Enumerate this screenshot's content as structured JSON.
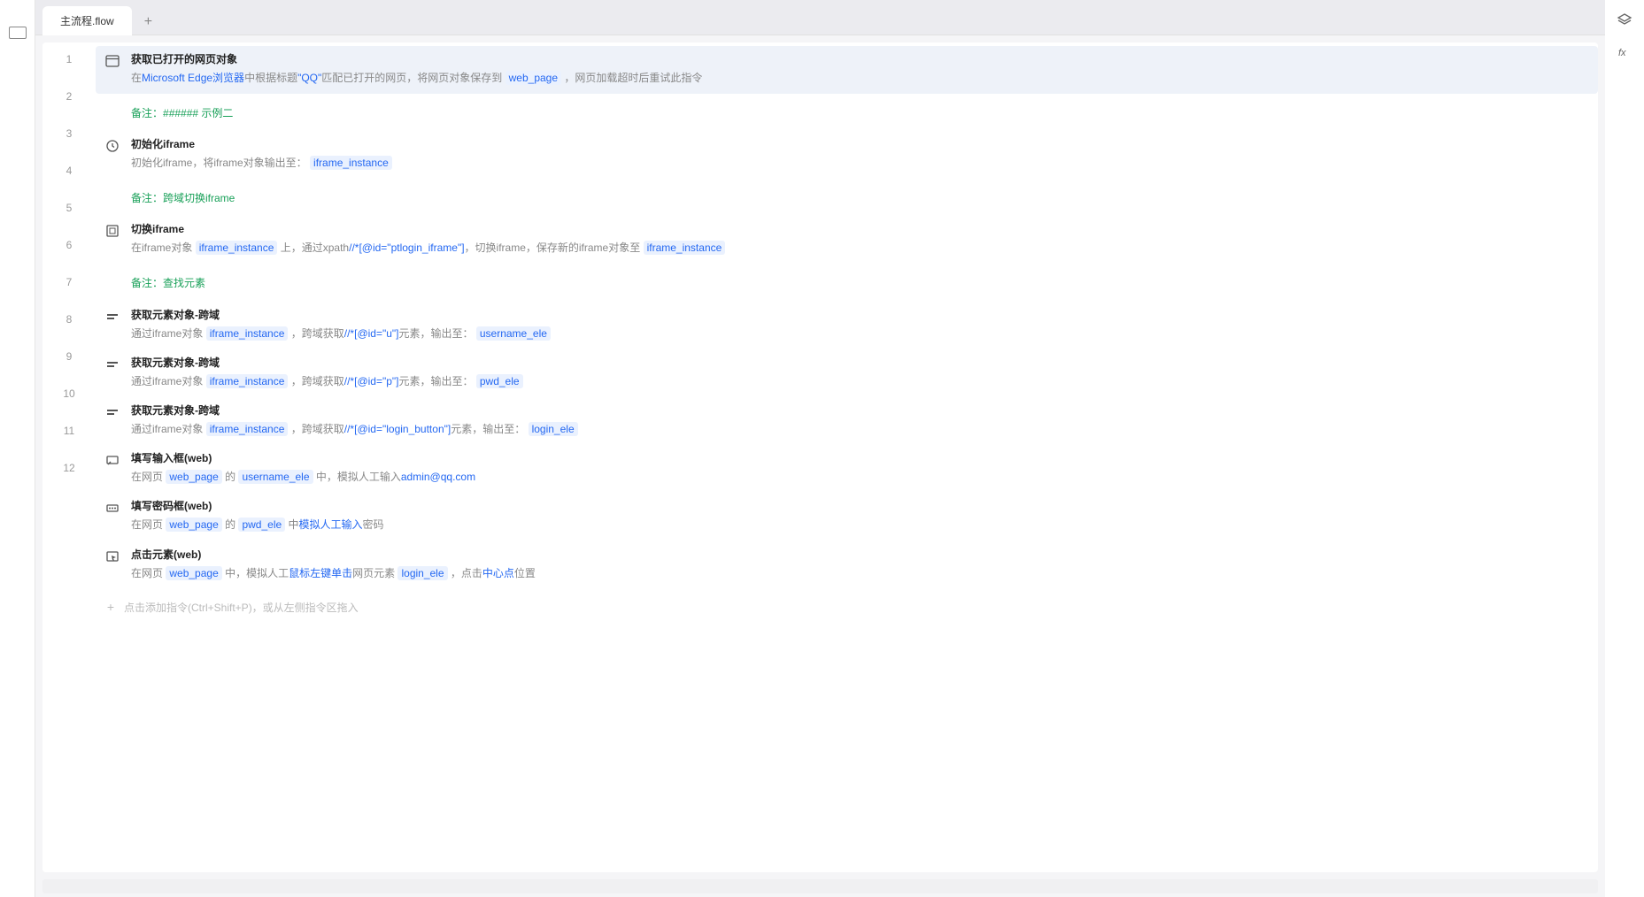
{
  "tabs": {
    "active": "主流程.flow"
  },
  "lines": [
    "1",
    "2",
    "3",
    "4",
    "5",
    "6",
    "7",
    "8",
    "9",
    "10",
    "11",
    "12"
  ],
  "steps": {
    "s1": {
      "title": "获取已打开的网页对象",
      "d1": "在",
      "d2": "Microsoft Edge浏览器",
      "d3": "中根据标题",
      "d4": "\"QQ\"",
      "d5": "匹配已打开的网页，将网页对象保存到",
      "d6": "web_page",
      "d7": "，网页加载超时后重试此指令"
    },
    "n1": {
      "label": "备注：",
      "text": "###### 示例二"
    },
    "s2": {
      "title": "初始化iframe",
      "d1": "初始化iframe，将iframe对象输出至：",
      "d2": "iframe_instance"
    },
    "n2": {
      "label": "备注：",
      "text": "跨域切换iframe"
    },
    "s3": {
      "title": "切换iframe",
      "d1": "在iframe对象",
      "d2": "iframe_instance",
      "d3": "上，通过xpath",
      "d4": "//*[@id=\"ptlogin_iframe\"]",
      "d5": "，切换iframe，保存新的iframe对象至",
      "d6": "iframe_instance"
    },
    "n3": {
      "label": "备注：",
      "text": "查找元素"
    },
    "s4": {
      "title": "获取元素对象-跨域",
      "d1": "通过iframe对象",
      "d2": "iframe_instance",
      "d3": "，跨域获取",
      "d4": "//*[@id=\"u\"]",
      "d5": "元素，输出至：",
      "d6": "username_ele"
    },
    "s5": {
      "title": "获取元素对象-跨域",
      "d1": "通过iframe对象",
      "d2": "iframe_instance",
      "d3": "，跨域获取",
      "d4": "//*[@id=\"p\"]",
      "d5": "元素，输出至：",
      "d6": "pwd_ele"
    },
    "s6": {
      "title": "获取元素对象-跨域",
      "d1": "通过iframe对象",
      "d2": "iframe_instance",
      "d3": "，跨域获取",
      "d4": "//*[@id=\"login_button\"]",
      "d5": "元素，输出至：",
      "d6": "login_ele"
    },
    "s7": {
      "title": "填写输入框(web)",
      "d1": "在网页",
      "d2": "web_page",
      "d3": "的",
      "d4": "username_ele",
      "d5": "中，模拟人工输入",
      "d6": "admin@qq.com"
    },
    "s8": {
      "title": "填写密码框(web)",
      "d1": "在网页",
      "d2": "web_page",
      "d3": "的",
      "d4": "pwd_ele",
      "d5": "中",
      "d6": "模拟人工输入",
      "d7": "密码"
    },
    "s9": {
      "title": "点击元素(web)",
      "d1": "在网页",
      "d2": "web_page",
      "d3": "中，模拟人工",
      "d4": "鼠标左键单击",
      "d5": "网页元素",
      "d6": "login_ele",
      "d7": "，点击",
      "d8": "中心点",
      "d9": "位置"
    }
  },
  "addHint": "点击添加指令(Ctrl+Shift+P)，或从左侧指令区拖入"
}
